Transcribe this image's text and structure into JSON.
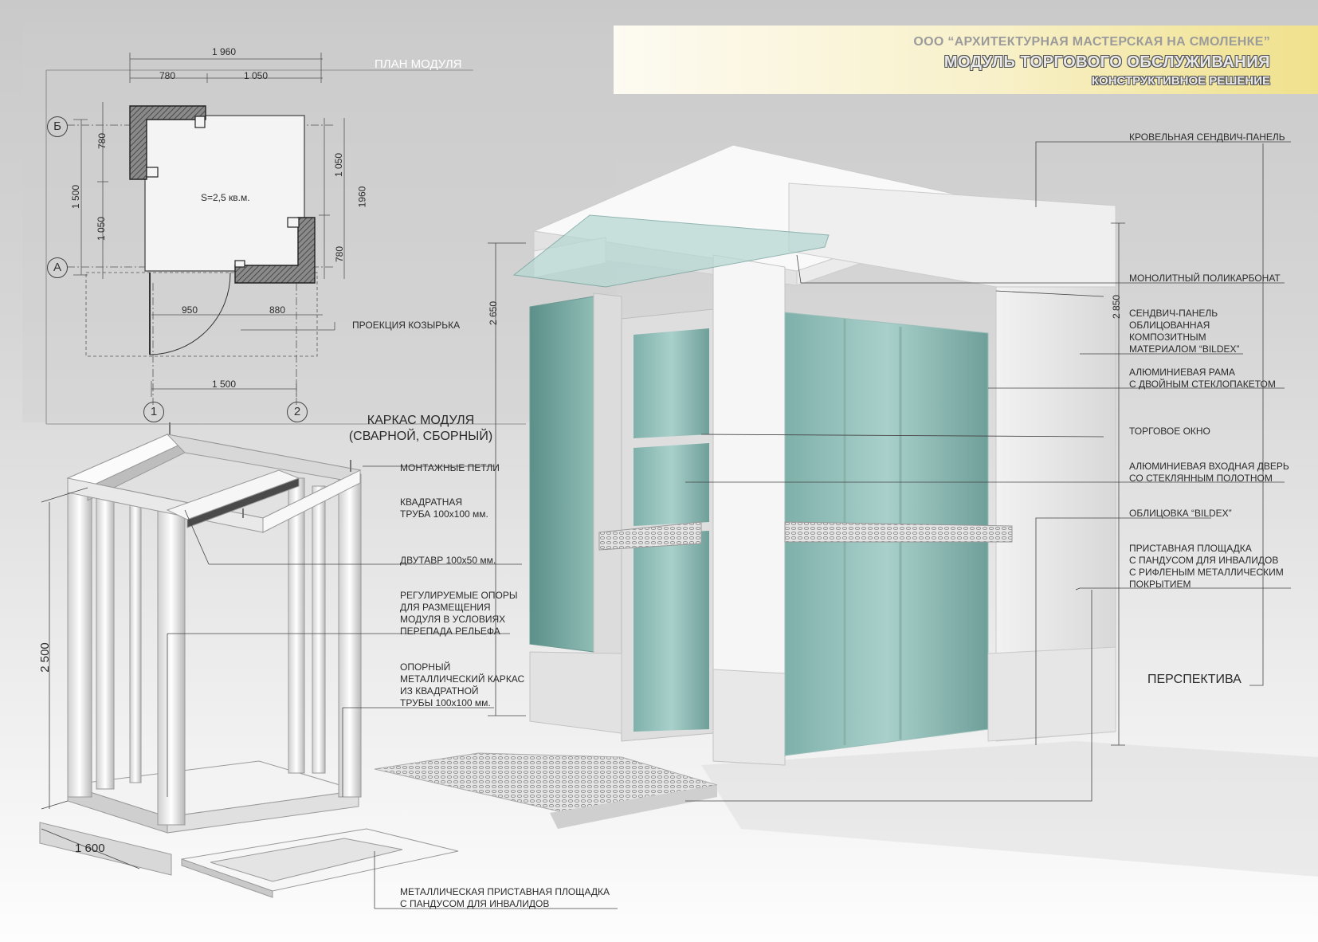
{
  "header": {
    "org": "ООО “АРХИТЕКТУРНАЯ МАСТЕРСКАЯ НА СМОЛЕНКЕ”",
    "title": "МОДУЛЬ ТОРГОВОГО ОБСЛУЖИВАНИЯ",
    "subtitle": "КОНСТРУКТИВНОЕ РЕШЕНИЕ"
  },
  "plan": {
    "title": "ПЛАН МОДУЛЯ",
    "area": "S=2,5 кв.м.",
    "canopy": "ПРОЕКЦИЯ КОЗЫРЬКА",
    "axes": {
      "b": "Б",
      "a": "А",
      "one": "1",
      "two": "2"
    },
    "dims": {
      "top_total": "1 960",
      "top_left": "780",
      "top_right": "1 050",
      "left_top": "780",
      "left_mid": "1 050",
      "left_total": "1 500",
      "right_top": "1 050",
      "right_bottom": "780",
      "right_total": "1960",
      "bottom_left": "950",
      "bottom_right": "880",
      "bottom_axis": "1 500"
    }
  },
  "frame": {
    "title_line1": "КАРКАС МОДУЛЯ",
    "title_line2": "(СВАРНОЙ, СБОРНЫЙ)",
    "height": "2 500",
    "width": "1 600",
    "labels": {
      "loops": "МОНТАЖНЫЕ ПЕТЛИ",
      "pipe": [
        "КВАДРАТНАЯ",
        "ТРУБА 100х100 мм."
      ],
      "ibeam": "ДВУТАВР 100х50 мм.",
      "supports": [
        "РЕГУЛИРУЕМЫЕ ОПОРЫ",
        "ДЛЯ РАЗМЕЩЕНИЯ",
        "МОДУЛЯ В УСЛОВИЯХ",
        "ПЕРЕПАДА РЕЛЬЕФА"
      ],
      "base": [
        "ОПОРНЫЙ",
        "МЕТАЛЛИЧЕСКИЙ КАРКАС",
        "ИЗ КВАДРАТНОЙ",
        "ТРУБЫ 100х100 мм."
      ],
      "platform": [
        "МЕТАЛЛИЧЕСКАЯ ПРИСТАВНАЯ ПЛОЩАДКА",
        "С ПАНДУСОМ ДЛЯ ИНВАЛИДОВ"
      ]
    }
  },
  "perspective": {
    "title": "ПЕРСПЕКТИВА",
    "height_left": "2 650",
    "height_right": "2 850",
    "labels": {
      "roof": "КРОВЕЛЬНАЯ СЕНДВИЧ-ПАНЕЛЬ",
      "polycarb": "МОНОЛИТНЫЙ ПОЛИКАРБОНАТ",
      "sandwich": [
        "СЕНДВИЧ-ПАНЕЛЬ",
        "ОБЛИЦОВАННАЯ",
        "КОМПОЗИТНЫМ",
        "МАТЕРИАЛОМ “BILDEX”"
      ],
      "frame_glass": [
        "АЛЮМИНИЕВАЯ РАМА",
        "С ДВОЙНЫМ СТЕКЛОПАКЕТОМ"
      ],
      "window": "ТОРГОВОЕ ОКНО",
      "door": [
        "АЛЮМИНИЕВАЯ ВХОДНАЯ ДВЕРЬ",
        "СО СТЕКЛЯННЫМ ПОЛОТНОМ"
      ],
      "cladding": "ОБЛИЦОВКА “BILDEX”",
      "platform": [
        "ПРИСТАВНАЯ ПЛОЩАДКА",
        "С ПАНДУСОМ ДЛЯ ИНВАЛИДОВ",
        "С РИФЛЕНЫМ МЕТАЛЛИЧЕСКИМ",
        "ПОКРЫТИЕМ"
      ]
    }
  }
}
